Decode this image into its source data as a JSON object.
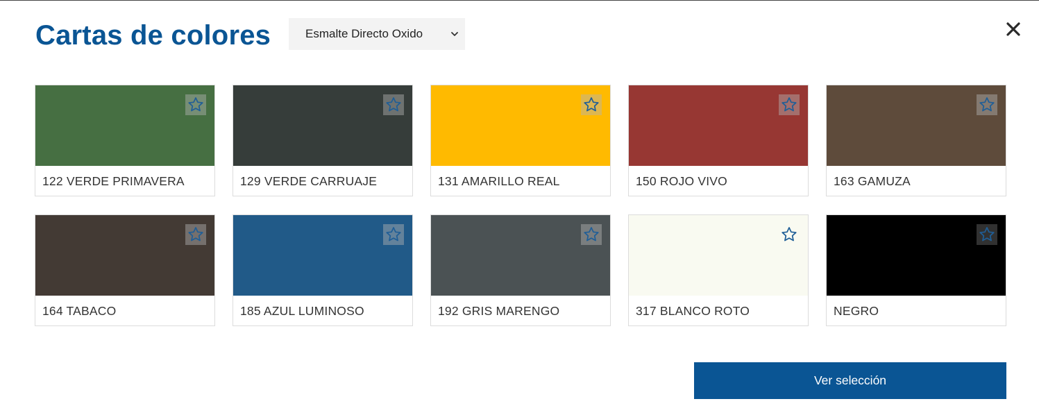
{
  "header": {
    "title": "Cartas de colores",
    "select_value": "Esmalte Directo Oxido"
  },
  "colors": [
    {
      "label": "122 VERDE PRIMAVERA",
      "hex": "#466f42"
    },
    {
      "label": "129 VERDE CARRUAJE",
      "hex": "#363d3a"
    },
    {
      "label": "131 AMARILLO REAL",
      "hex": "#ffba00"
    },
    {
      "label": "150 ROJO VIVO",
      "hex": "#973733"
    },
    {
      "label": "163 GAMUZA",
      "hex": "#5e4b3b"
    },
    {
      "label": "164 TABACO",
      "hex": "#433a34"
    },
    {
      "label": "185 AZUL LUMINOSO",
      "hex": "#215a88"
    },
    {
      "label": "192 GRIS MARENGO",
      "hex": "#4b5254"
    },
    {
      "label": "317 BLANCO ROTO",
      "hex": "#f9faf1"
    },
    {
      "label": "NEGRO",
      "hex": "#000000"
    }
  ],
  "footer": {
    "button_label": "Ver selección"
  },
  "theme": {
    "accent": "#0a5594",
    "star_color": "#1f5e97"
  }
}
